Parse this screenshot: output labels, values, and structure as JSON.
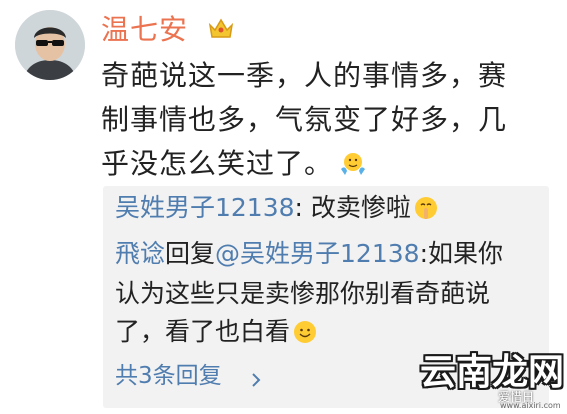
{
  "user": {
    "name": "温七安"
  },
  "post": {
    "lines": [
      "奇葩说这一季，人的事情多，赛",
      "制事情也多，气氛变了好多，几",
      "乎没怎么笑过了。"
    ]
  },
  "replies": {
    "first": {
      "author": "吴姓男子12138",
      "colon": ":",
      "text": " 改卖惨啦"
    },
    "second": {
      "author": "飛谂",
      "verb": "回复",
      "mention": "@吴姓男子12138",
      "line1": ":如果你",
      "line2": "认为这些只是卖惨那你别看奇葩说",
      "line3": "了，看了也白看"
    },
    "more_label": "共3条回复"
  },
  "watermark": {
    "title": "云南龙网",
    "sub": "爱惜日",
    "url": "www.aixiri.com"
  },
  "colors": {
    "username": "#eb7350",
    "link": "#507daf",
    "reply_bg": "#f2f2f2"
  },
  "icons": [
    "avatar",
    "crown-icon",
    "hands-emoji-icon",
    "shush-emoji-icon",
    "smile-emoji-icon",
    "chevron-right-icon"
  ]
}
